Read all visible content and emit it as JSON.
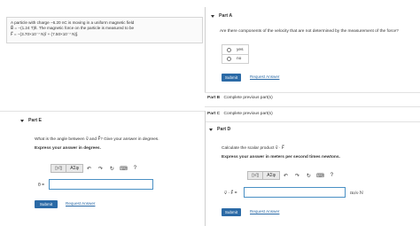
{
  "problem": {
    "line1": "A particle with charge −6.20 nC is moving in a uniform magnetic field",
    "line2": "B⃗ = −(1.24 T)k̂. The magnetic force on the particle is measured to be",
    "line3": "F⃗ = −(3.70×10⁻⁷ N)î + (7.50×10⁻⁷ N)ĵ."
  },
  "partA": {
    "title": "Part A",
    "question": "Are there components of the velocity that are not determined by the measurement of the force?",
    "options": [
      "yes",
      "no"
    ],
    "submit": "Submit",
    "request": "Request Answer"
  },
  "partB": {
    "label": "Part B",
    "status": "Complete previous part(s)"
  },
  "partC": {
    "label": "Part C",
    "status": "Complete previous part(s)"
  },
  "partE": {
    "title": "Part E",
    "question": "What is the angle between v⃗ and F⃗? Give your answer in degrees.",
    "instruction": "Express your answer in degrees.",
    "input_label": "θ =",
    "submit": "Submit",
    "request": "Request Answer"
  },
  "partD": {
    "title": "Part D",
    "question": "Calculate the scalar product v⃗ · F⃗",
    "instruction": "Express your answer in meters per second times newtons.",
    "input_label": "v⃗ · F⃗ =",
    "unit": "m/s·N",
    "submit": "Submit",
    "request": "Request Answer"
  },
  "toolbar": {
    "templates": "▯√▯",
    "symbols": "ΑΣφ",
    "undo": "↶",
    "redo": "↷",
    "reset": "↻",
    "keyboard": "⌨",
    "help": "?"
  },
  "colors": {
    "accent": "#2b6aa6",
    "border": "#cfcfcf"
  }
}
